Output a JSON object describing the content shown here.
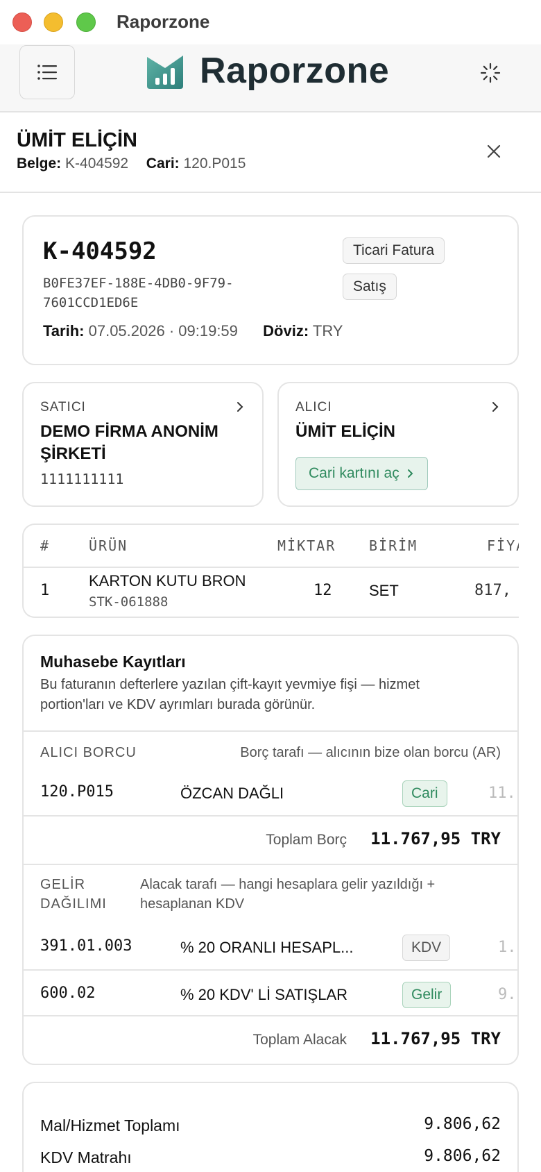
{
  "window": {
    "title": "Raporzone"
  },
  "app": {
    "brand": "Raporzone"
  },
  "detail": {
    "name": "ÜMİT ELİÇİN",
    "belge_label": "Belge:",
    "belge_value": "K-404592",
    "cari_label": "Cari:",
    "cari_value": "120.P015"
  },
  "document": {
    "number": "K-404592",
    "uuid": "B0FE37EF-188E-4DB0-9F79-7601CCD1ED6E",
    "tarih_label": "Tarih:",
    "tarih_value": "07.05.2026 · 09:19:59",
    "doviz_label": "Döviz:",
    "doviz_value": "TRY",
    "type_chip": "Ticari Fatura",
    "kind_chip": "Satış"
  },
  "seller": {
    "kicker": "SATICI",
    "name": "DEMO FİRMA ANONİM ŞİRKETİ",
    "tax_no": "1111111111"
  },
  "buyer": {
    "kicker": "ALICI",
    "name": "ÜMİT ELİÇİN",
    "open_button": "Cari kartını aç"
  },
  "products": {
    "headers": [
      "#",
      "ÜRÜN",
      "MİKTAR",
      "BİRİM",
      "FİYA"
    ],
    "rows": [
      {
        "no": "1",
        "name": "KARTON KUTU BRON",
        "code": "STK-061888",
        "qty": "12",
        "unit": "SET",
        "price": "817,"
      }
    ]
  },
  "accounting": {
    "title": "Muhasebe Kayıtları",
    "description": "Bu faturanın defterlere yazılan çift-kayıt yevmiye fişi — hizmet portion'ları ve KDV ayrımları burada görünür.",
    "debit_section": {
      "label": "ALICI BORCU",
      "description": "Borç tarafı — alıcının bize olan borcu (AR)",
      "rows": [
        {
          "code": "120.P015",
          "name": "ÖZCAN DAĞLI",
          "tag": "Cari",
          "amount": "11."
        }
      ],
      "total_label": "Toplam Borç",
      "total_value": "11.767,95 TRY"
    },
    "credit_section": {
      "label_line1": "GELİR",
      "label_line2": "DAĞILIMI",
      "description": "Alacak tarafı — hangi hesaplara gelir yazıldığı + hesaplanan KDV",
      "rows": [
        {
          "code": "391.01.003",
          "name": "% 20 ORANLI HESAPL...",
          "tag": "KDV",
          "amount": "1."
        },
        {
          "code": "600.02",
          "name": "% 20 KDV' Lİ SATIŞLAR",
          "tag": "Gelir",
          "amount": "9."
        }
      ],
      "total_label": "Toplam Alacak",
      "total_value": "11.767,95 TRY"
    }
  },
  "summary": {
    "rows": [
      {
        "label": "Mal/Hizmet Toplamı",
        "value": "9.806,62"
      },
      {
        "label": "KDV Matrahı",
        "value": "9.806,62"
      }
    ]
  },
  "colors": {
    "accent_green": "#2f8a5e",
    "brand_dark": "#1f2d33",
    "logo_teal": "#3f8f8a"
  }
}
